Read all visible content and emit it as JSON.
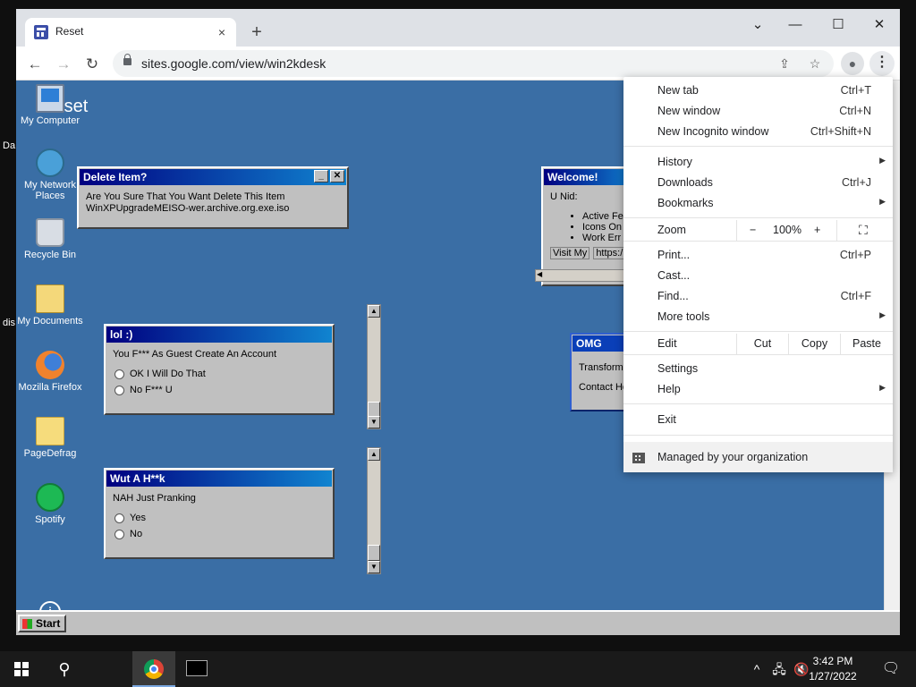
{
  "host_desktop": {
    "left_fragment_1": "Da",
    "left_fragment_2": "dis"
  },
  "browser": {
    "tab": {
      "title": "Reset",
      "close_glyph": "×"
    },
    "new_tab_glyph": "+",
    "window_controls": {
      "minimize": "—",
      "maximize": "☐",
      "close": "✕",
      "dropdown": "⌄"
    },
    "url": "sites.google.com/view/win2kdesk",
    "nav": {
      "back": "←",
      "forward": "→",
      "reload": "↻"
    }
  },
  "page": {
    "heading": "Reset",
    "desktop_icons": [
      {
        "label": "My Computer",
        "icon": "computer-icon"
      },
      {
        "label": "My Network Places",
        "icon": "network-icon"
      },
      {
        "label": "Recycle Bin",
        "icon": "recycle-bin-icon"
      },
      {
        "label": "My Documents",
        "icon": "documents-icon"
      },
      {
        "label": "Mozilla Firefox",
        "icon": "firefox-icon"
      },
      {
        "label": "PageDefrag",
        "icon": "folder-icon"
      },
      {
        "label": "Spotify",
        "icon": "spotify-icon"
      }
    ],
    "delete_window": {
      "title": "Delete Item?",
      "line1": "Are You Sure That You Want Delete This Item",
      "line2": "WinXPUpgradeMEISO-wer.archive.org.exe.iso"
    },
    "lol_window": {
      "title": "lol :)",
      "text": "You F*** As Guest Create An Account",
      "options": [
        "OK I Will Do That",
        "No F*** U"
      ]
    },
    "wut_window": {
      "title": "Wut A H**k",
      "text": "NAH Just Pranking",
      "options": [
        "Yes",
        "No"
      ]
    },
    "welcome_window": {
      "title": "Welcome!",
      "text": "U Nid:",
      "bullets": [
        "Active Fe",
        "Icons On",
        "Work Err"
      ],
      "tabs": [
        "Visit My",
        "https:/"
      ]
    },
    "omg_window": {
      "title": "OMG",
      "lines": [
        "Transform",
        "Contact He"
      ]
    },
    "start_label": "Start"
  },
  "menu": {
    "group1": [
      {
        "label": "New tab",
        "shortcut": "Ctrl+T"
      },
      {
        "label": "New window",
        "shortcut": "Ctrl+N"
      },
      {
        "label": "New Incognito window",
        "shortcut": "Ctrl+Shift+N"
      }
    ],
    "group2": [
      {
        "label": "History",
        "shortcut": ""
      },
      {
        "label": "Downloads",
        "shortcut": "Ctrl+J"
      },
      {
        "label": "Bookmarks",
        "shortcut": ""
      }
    ],
    "zoom": {
      "label": "Zoom",
      "minus": "−",
      "value": "100%",
      "plus": "+",
      "fullscreen": "⛶"
    },
    "group3": [
      {
        "label": "Print...",
        "shortcut": "Ctrl+P"
      },
      {
        "label": "Cast...",
        "shortcut": ""
      },
      {
        "label": "Find...",
        "shortcut": "Ctrl+F"
      },
      {
        "label": "More tools",
        "shortcut": ""
      }
    ],
    "edit": {
      "label": "Edit",
      "cut": "Cut",
      "copy": "Copy",
      "paste": "Paste"
    },
    "group4": [
      {
        "label": "Settings"
      },
      {
        "label": "Help"
      }
    ],
    "exit": "Exit",
    "managed": "Managed by your organization"
  },
  "taskbar": {
    "search_glyph": "⚲",
    "tray": {
      "chevron": "^",
      "network": "🖧",
      "volume": "🔇"
    },
    "time": "3:42 PM",
    "date": "1/27/2022",
    "notification_glyph": "🗨"
  }
}
